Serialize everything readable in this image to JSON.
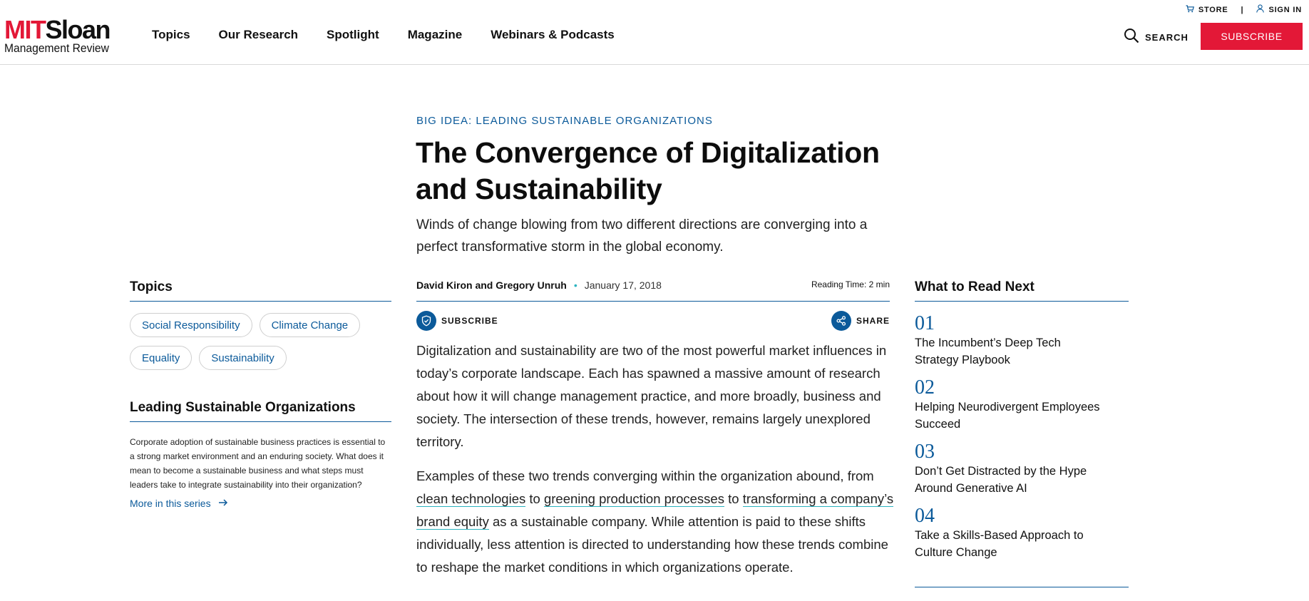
{
  "brand": {
    "logo_mit": "MIT",
    "logo_sloan": "Sloan",
    "logo_sub": "Management Review",
    "accent": "#e31837",
    "link_color": "#0b5a9a"
  },
  "nav": {
    "items": [
      "Topics",
      "Our Research",
      "Spotlight",
      "Magazine",
      "Webinars & Podcasts"
    ]
  },
  "utility": {
    "store": "STORE",
    "separator": "|",
    "signin": "SIGN IN",
    "search": "SEARCH",
    "subscribe": "SUBSCRIBE"
  },
  "article": {
    "kicker": "BIG IDEA: LEADING SUSTAINABLE ORGANIZATIONS",
    "title": "The Convergence of Digitalization and Sustainability",
    "dek": "Winds of change blowing from two different directions are converging into a perfect transformative storm in the global economy.",
    "authors": "David Kiron and Gregory Unruh",
    "dot": "•",
    "date": "January 17, 2018",
    "reading_time": "Reading Time: 2 min",
    "subscribe_action": "SUBSCRIBE",
    "share_action": "SHARE",
    "p1": "Digitalization and sustainability are two of the most powerful market influences in today’s corporate landscape. Each has spawned a massive amount of research about how it will change management practice, and more broadly, business and society. The intersection of these trends, however, remains largely unexplored territory.",
    "p2_start": "Examples of these two trends converging within the organization abound, from ",
    "p2_link1": "clean technologies",
    "p2_to1": " to ",
    "p2_link2": "greening production processes",
    "p2_to2": " to ",
    "p2_link3": "transforming a company’s brand equity",
    "p2_end": " as a sustainable company. While attention is paid to these shifts individually, less attention is directed to understanding how these trends combine to reshape the market conditions in which organizations operate."
  },
  "sidebar_left": {
    "topics_heading": "Topics",
    "tags": [
      "Social Responsibility",
      "Climate Change",
      "Equality",
      "Sustainability"
    ],
    "series_heading": "Leading Sustainable Organizations",
    "series_desc": "Corporate adoption of sustainable business practices is essential to a strong market environment and an enduring society. What does it mean to become a sustainable business and what steps must leaders take to integrate sustainability into their organization?",
    "more_link": "More in this series"
  },
  "sidebar_right": {
    "heading": "What to Read Next",
    "items": [
      {
        "num": "01",
        "title": "The Incumbent’s Deep Tech Strategy Playbook"
      },
      {
        "num": "02",
        "title": "Helping Neurodivergent Employees Succeed"
      },
      {
        "num": "03",
        "title": "Don’t Get Distracted by the Hype Around Generative AI"
      },
      {
        "num": "04",
        "title": "Take a Skills-Based Approach to Culture Change"
      }
    ]
  }
}
